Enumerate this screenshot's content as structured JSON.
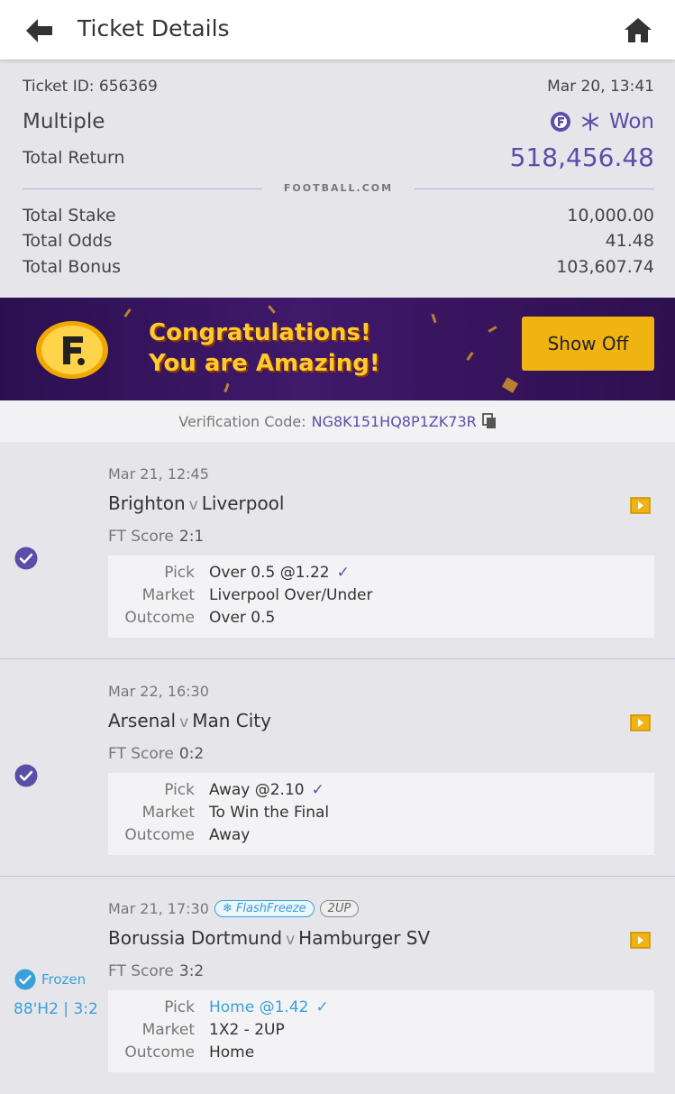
{
  "header": {
    "title": "Ticket Details"
  },
  "summary": {
    "ticket_id": "Ticket ID: 656369",
    "date": "Mar 20, 13:41",
    "bet_type": "Multiple",
    "status": "Won",
    "total_return_label": "Total Return",
    "total_return": "518,456.48",
    "brand": "FOOTBALL.COM",
    "stats": [
      {
        "label": "Total Stake",
        "value": "10,000.00"
      },
      {
        "label": "Total Odds",
        "value": "41.48"
      },
      {
        "label": "Total Bonus",
        "value": "103,607.74"
      }
    ]
  },
  "banner": {
    "line1": "Congratulations!",
    "line2": "You are Amazing!",
    "button": "Show Off"
  },
  "verification": {
    "label": "Verification Code:",
    "code": "NG8K151HQ8P1ZK73R"
  },
  "labels": {
    "ft_score": "FT Score",
    "pick": "Pick",
    "market": "Market",
    "outcome": "Outcome",
    "vs": "v"
  },
  "matches": [
    {
      "date": "Mar 21, 12:45",
      "home": "Brighton",
      "away": "Liverpool",
      "ft_score": "2:1",
      "pick": "Over 0.5 @1.22",
      "market": "Liverpool Over/Under",
      "outcome": "Over 0.5"
    },
    {
      "date": "Mar 22, 16:30",
      "home": "Arsenal",
      "away": "Man City",
      "ft_score": "0:2",
      "pick": "Away @2.10",
      "market": "To Win the Final",
      "outcome": "Away"
    },
    {
      "date": "Mar 21, 17:30",
      "home": "Borussia Dortmund",
      "away": "Hamburger SV",
      "ft_score": "3:2",
      "pick": "Home @1.42",
      "market": "1X2 - 2UP",
      "outcome": "Home",
      "badge_flashfreeze": "FlashFreeze",
      "badge_2up": "2UP",
      "frozen_label": "Frozen",
      "frozen_score": "88'H2 | 3:2"
    }
  ],
  "colors": {
    "accent": "#5a4ea8",
    "freeze": "#3aa0d9",
    "gold": "#f0b312"
  }
}
